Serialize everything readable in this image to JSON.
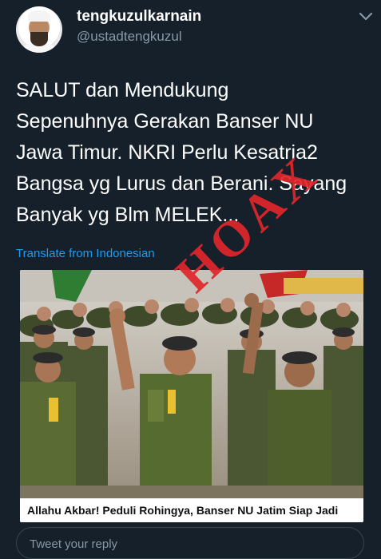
{
  "user": {
    "name": "tengkuzulkarnain",
    "handle": "@ustadtengkuzul"
  },
  "tweet": {
    "text": "SALUT dan Mendukung\nSepenuhnya Gerakan Banser NU\nJawa Timur. NKRI Perlu Kesatria2\nBangsa yg Lurus dan Berani. Sayang\nBanyak yg Blm MELEK...",
    "translate_label": "Translate from Indonesian"
  },
  "overlay": {
    "stamp_text": "HOAX",
    "stamp_color": "#e0262a"
  },
  "card": {
    "caption": "Allahu Akbar! Peduli Rohingya, Banser NU Jatim Siap Jadi"
  },
  "reply": {
    "placeholder": "Tweet your reply"
  },
  "icons": {
    "more": "chevron-down-icon"
  },
  "colors": {
    "background": "#15202b",
    "link": "#1d9bf0",
    "secondary_text": "#8899a6"
  }
}
